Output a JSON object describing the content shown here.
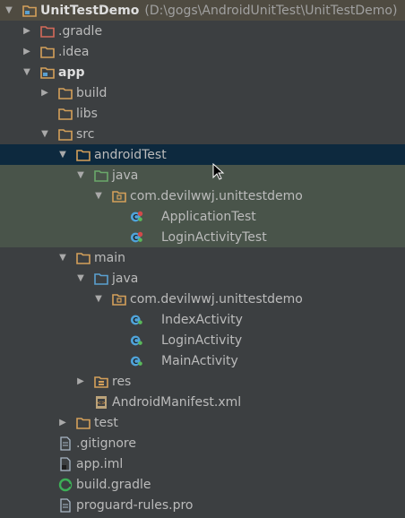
{
  "project": {
    "name": "UnitTestDemo",
    "path": "(D:\\gogs\\AndroidUnitTest\\UnitTestDemo)"
  },
  "tree": [
    {
      "label": "UnitTestDemo",
      "icon": "module-folder-icon",
      "expanded": true
    },
    {
      "label": ".gradle",
      "icon": "folder-excluded-icon",
      "expanded": false
    },
    {
      "label": ".idea",
      "icon": "folder-icon",
      "expanded": false
    },
    {
      "label": "app",
      "icon": "module-folder-icon",
      "expanded": true
    },
    {
      "label": "build",
      "icon": "folder-icon",
      "expanded": false
    },
    {
      "label": "libs",
      "icon": "folder-icon"
    },
    {
      "label": "src",
      "icon": "folder-icon",
      "expanded": true
    },
    {
      "label": "androidTest",
      "icon": "folder-icon",
      "expanded": true
    },
    {
      "label": "java",
      "icon": "test-source-folder-icon",
      "expanded": true
    },
    {
      "label": "com.devilwwj.unittestdemo",
      "icon": "package-icon",
      "expanded": true
    },
    {
      "label": "ApplicationTest",
      "icon": "test-class-icon"
    },
    {
      "label": "LoginActivityTest",
      "icon": "test-class-icon"
    },
    {
      "label": "main",
      "icon": "folder-icon",
      "expanded": true
    },
    {
      "label": "java",
      "icon": "source-folder-icon",
      "expanded": true
    },
    {
      "label": "com.devilwwj.unittestdemo",
      "icon": "package-icon",
      "expanded": true
    },
    {
      "label": "IndexActivity",
      "icon": "class-icon"
    },
    {
      "label": "LoginActivity",
      "icon": "class-icon"
    },
    {
      "label": "MainActivity",
      "icon": "class-icon"
    },
    {
      "label": "res",
      "icon": "resource-folder-icon",
      "expanded": false
    },
    {
      "label": "AndroidManifest.xml",
      "icon": "xml-file-icon"
    },
    {
      "label": "test",
      "icon": "folder-icon",
      "expanded": false
    },
    {
      "label": ".gitignore",
      "icon": "text-file-icon"
    },
    {
      "label": "app.iml",
      "icon": "iml-file-icon"
    },
    {
      "label": "build.gradle",
      "icon": "gradle-file-icon"
    },
    {
      "label": "proguard-rules.pro",
      "icon": "text-file-icon"
    }
  ],
  "colors": {
    "background": "#3c3f41",
    "selection": "#0d293e",
    "test_source_highlight": "#49544a",
    "top_row": "#4f4b41",
    "folder": "#d4a05a",
    "source_folder": "#5aa0d0",
    "test_folder": "#6aa86a",
    "excluded_folder": "#d46a5a"
  }
}
